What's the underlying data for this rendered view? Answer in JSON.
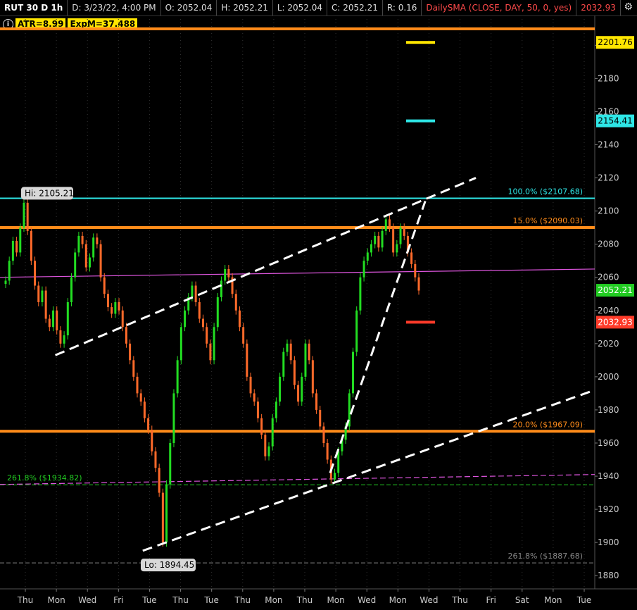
{
  "header": {
    "symbol": "RUT 30 D 1h",
    "date": "D: 3/23/22, 4:00 PM",
    "open": "O: 2052.04",
    "high": "H: 2052.21",
    "low": "L: 2052.04",
    "close": "C: 2052.21",
    "range": "R: 0.16",
    "study": "DailySMA (CLOSE, DAY, 50, 0, yes)",
    "study_value": "2032.93"
  },
  "indicators": {
    "info_glyph": "i",
    "atr": "ATR=8.99",
    "expm": "ExpM=37.488"
  },
  "colors": {
    "background": "#000000",
    "up": "#22dd22",
    "down": "#ff6a2a",
    "orange_level": "#ff8c1a",
    "cyan_level": "#2ee6e6",
    "sma_line": "#dd55dd",
    "trend": "#ffffff"
  },
  "chart_data": {
    "type": "candlestick",
    "ylim": [
      1872,
      2218
    ],
    "y_ticks": [
      1880,
      1900,
      1920,
      1940,
      1960,
      1980,
      2000,
      2020,
      2040,
      2060,
      2080,
      2100,
      2120,
      2140,
      2160,
      2180,
      2200
    ],
    "x_ticks": [
      "Thu",
      "Mon",
      "Wed",
      "Fri",
      "Tue",
      "Thu",
      "Tue",
      "Thu",
      "Mon",
      "Thu",
      "Mon",
      "Wed",
      "Mon",
      "Wed",
      "Thu",
      "Fri",
      "Sat",
      "Mon",
      "Tue"
    ],
    "hi_label": "Hi: 2105.21",
    "lo_label": "Lo: 1894.45",
    "price_bubbles": [
      {
        "value": 2201.76,
        "text": "2201.76",
        "color": "#ffe600"
      },
      {
        "value": 2154.41,
        "text": "2154.41",
        "color": "#2ee6e6"
      },
      {
        "value": 2052.21,
        "text": "2052.21",
        "color": "#22cc22"
      },
      {
        "value": 2032.93,
        "text": "2032.93",
        "color": "#ff3b2a"
      }
    ],
    "levels": [
      {
        "value": 2210,
        "label": "",
        "color": "#ff8c1a"
      },
      {
        "value": 2107.68,
        "label": "100.0% ($2107.68)",
        "color": "#2ee6e6"
      },
      {
        "value": 2090.03,
        "label": "15.0% ($2090.03)",
        "color": "#ff8c1a"
      },
      {
        "value": 1967.09,
        "label": "20.0% ($1967.09)",
        "color": "#ff8c1a"
      },
      {
        "value": 1934.82,
        "label": "261.8% ($1934.82)",
        "color": "#22cc22"
      },
      {
        "value": 1887.68,
        "label": "261.8% ($1887.68)",
        "color": "#888888"
      }
    ],
    "markers": [
      {
        "value": 2201.76,
        "color": "#ffe600"
      },
      {
        "value": 2154.41,
        "color": "#2ee6e6"
      },
      {
        "value": 2032.93,
        "color": "#ff3b2a"
      }
    ],
    "candles_close": [
      2058,
      2070,
      2082,
      2075,
      2090,
      2105,
      2088,
      2070,
      2055,
      2045,
      2052,
      2035,
      2030,
      2040,
      2028,
      2020,
      2025,
      2045,
      2060,
      2075,
      2085,
      2080,
      2066,
      2072,
      2084,
      2080,
      2060,
      2050,
      2042,
      2038,
      2045,
      2040,
      2030,
      2020,
      2010,
      2000,
      1990,
      1985,
      1975,
      1968,
      1955,
      1945,
      1930,
      1900,
      1935,
      1960,
      1990,
      2010,
      2030,
      2040,
      2048,
      2055,
      2045,
      2035,
      2030,
      2020,
      2010,
      2030,
      2048,
      2058,
      2065,
      2060,
      2050,
      2040,
      2030,
      2020,
      2000,
      1990,
      1985,
      1975,
      1965,
      1952,
      1958,
      1975,
      1985,
      2000,
      2015,
      2020,
      2010,
      1995,
      1985,
      2000,
      2020,
      2010,
      1990,
      1980,
      1970,
      1960,
      1950,
      1938,
      1942,
      1955,
      1962,
      1970,
      1990,
      2015,
      2040,
      2060,
      2070,
      2075,
      2080,
      2085,
      2078,
      2088,
      2095,
      2090,
      2075,
      2080,
      2090,
      2085,
      2075,
      2068,
      2060,
      2052
    ],
    "trendlines": [
      {
        "from": [
          0.093,
          2013
        ],
        "to": [
          0.8,
          2120
        ]
      },
      {
        "from": [
          0.24,
          1895
        ],
        "to": [
          1.0,
          1992
        ]
      },
      {
        "from": [
          0.555,
          1942
        ],
        "to": [
          0.715,
          2106
        ]
      }
    ],
    "sma": [
      {
        "from": [
          0.0,
          2060
        ],
        "to": [
          1.0,
          2065
        ]
      },
      {
        "from": [
          0.0,
          1935
        ],
        "to": [
          1.0,
          1941
        ]
      }
    ]
  }
}
